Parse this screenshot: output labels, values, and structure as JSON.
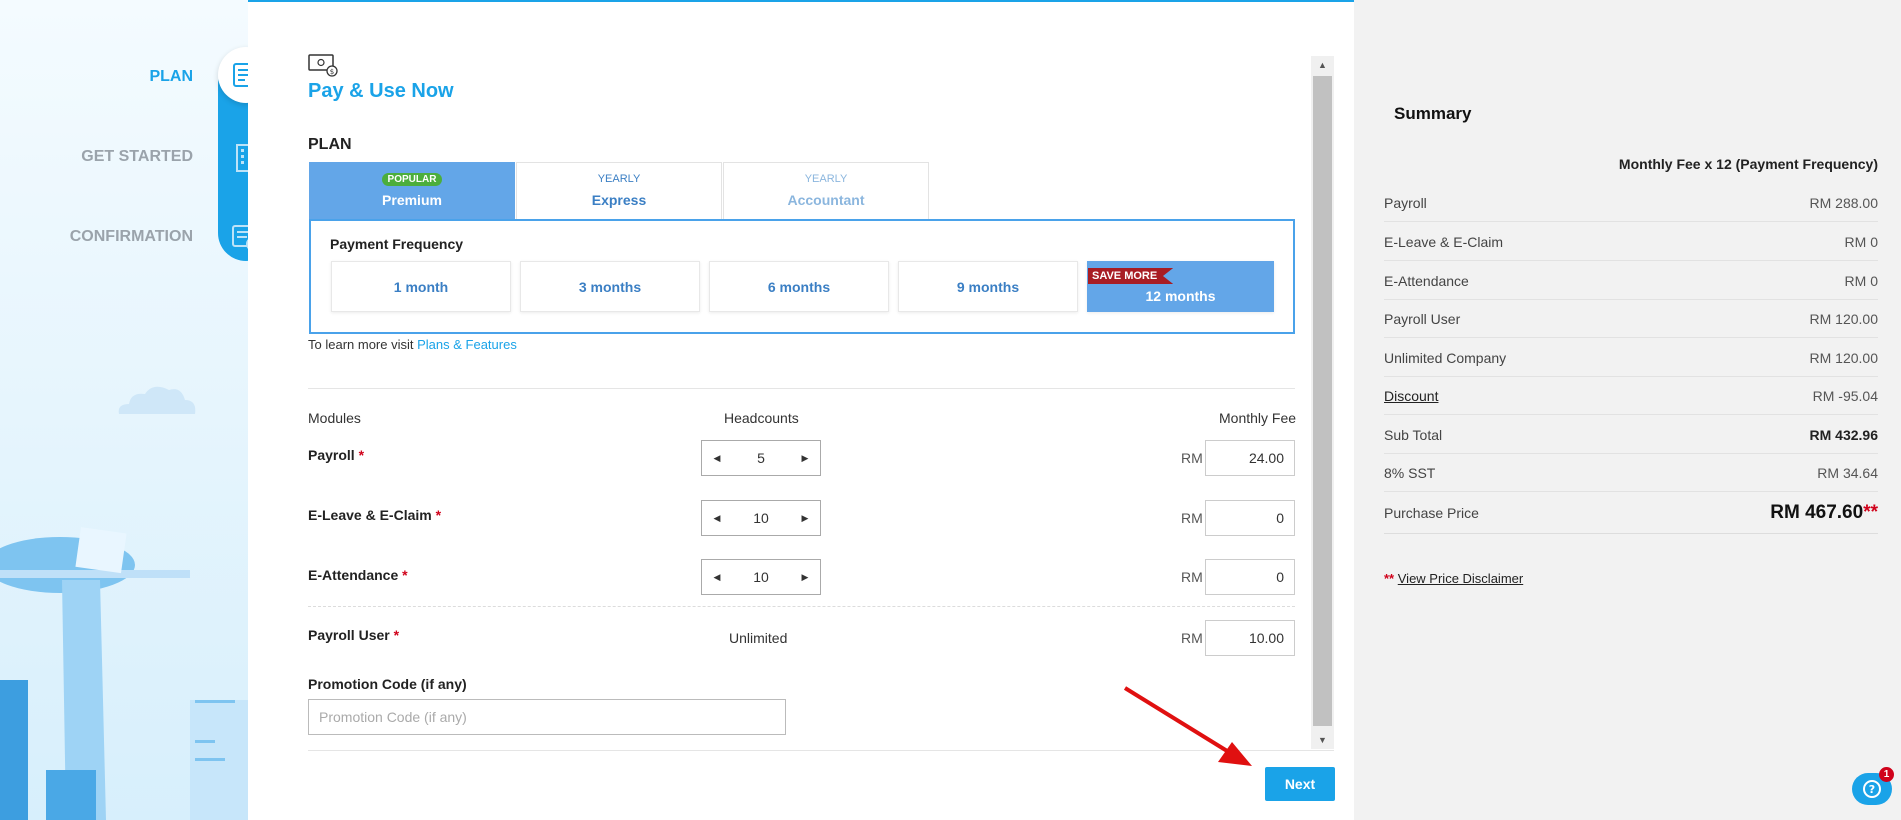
{
  "stepper": {
    "steps": [
      {
        "label": "PLAN",
        "active": true,
        "icon": "edit-document-icon"
      },
      {
        "label": "GET STARTED",
        "active": false,
        "icon": "building-icon"
      },
      {
        "label": "CONFIRMATION",
        "active": false,
        "icon": "document-check-icon"
      }
    ]
  },
  "header": {
    "title": "Pay & Use Now",
    "icon": "pay-card-icon"
  },
  "plan": {
    "heading": "PLAN",
    "tabs": [
      {
        "sub": "POPULAR",
        "name": "Premium",
        "active": true
      },
      {
        "sub": "YEARLY",
        "name": "Express",
        "active": false
      },
      {
        "sub": "YEARLY",
        "name": "Accountant",
        "active": false
      }
    ]
  },
  "frequency": {
    "title": "Payment Frequency",
    "options": [
      "1 month",
      "3 months",
      "6 months",
      "9 months",
      "12 months"
    ],
    "selected": "12 months",
    "ribbon": "SAVE MORE"
  },
  "learn_more": {
    "prefix": "To learn more visit",
    "link": "Plans & Features"
  },
  "modules": {
    "headers": {
      "module": "Modules",
      "headcount": "Headcounts",
      "fee": "Monthly Fee"
    },
    "currency": "RM",
    "rows": [
      {
        "name": "Payroll",
        "headcount": "5",
        "fee": "24.00"
      },
      {
        "name": "E-Leave & E-Claim",
        "headcount": "10",
        "fee": "0"
      },
      {
        "name": "E-Attendance",
        "headcount": "10",
        "fee": "0"
      }
    ],
    "payroll_user": {
      "name": "Payroll User",
      "headcount": "Unlimited",
      "fee": "10.00"
    },
    "required_mark": "*"
  },
  "promo": {
    "label": "Promotion Code (if any)",
    "placeholder": "Promotion Code (if any)"
  },
  "next_label": "Next",
  "summary": {
    "title": "Summary",
    "subtitle": "Monthly Fee x 12 (Payment Frequency)",
    "rows": [
      {
        "label": "Payroll",
        "value": "RM 288.00"
      },
      {
        "label": "E-Leave & E-Claim",
        "value": "RM 0"
      },
      {
        "label": "E-Attendance",
        "value": "RM 0"
      },
      {
        "label": "Payroll User",
        "value": "RM 120.00"
      },
      {
        "label": "Unlimited Company",
        "value": "RM 120.00"
      },
      {
        "label": "Discount",
        "value": "RM -95.04"
      },
      {
        "label": "Sub Total",
        "value": "RM 432.96"
      },
      {
        "label": "8% SST",
        "value": "RM 34.64"
      }
    ],
    "purchase": {
      "label": "Purchase Price",
      "value": "RM 467.60",
      "mark": "**"
    },
    "disclaimer": {
      "mark": "**",
      "link": "View Price Disclaimer"
    }
  },
  "help": {
    "badge": "1",
    "icon": "help-icon"
  },
  "colors": {
    "accent": "#1aa3e8",
    "selected": "#63a6e8",
    "ribbon": "#a81d24",
    "required": "#d0021b"
  }
}
